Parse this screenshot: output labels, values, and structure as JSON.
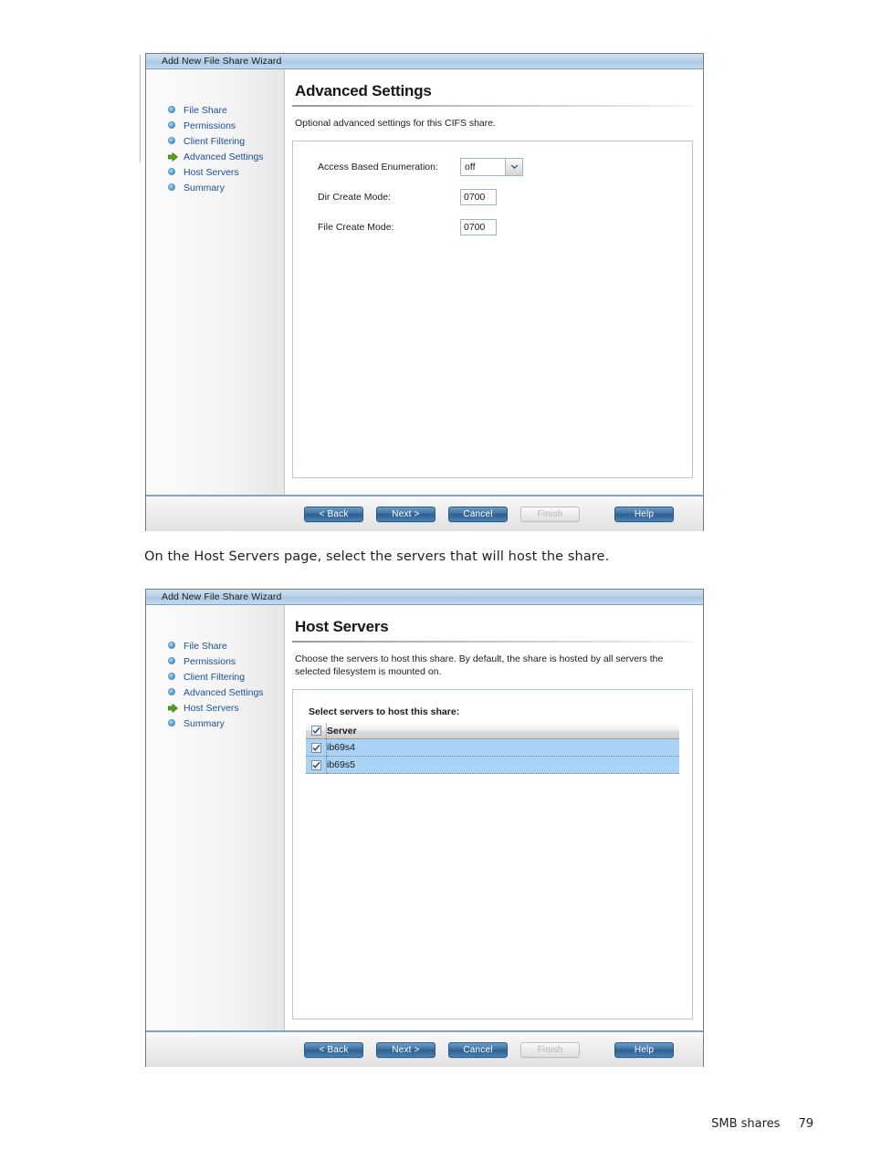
{
  "document": {
    "prose": "On the Host Servers page, select the servers that will host the share.",
    "footer_label": "SMB shares",
    "footer_page": "79"
  },
  "colors": {
    "link": "#1d4f91",
    "title_bar": "#b8d2ea",
    "button_primary": "#3f75a8",
    "row_selected": "#a8d3f7",
    "active_arrow": "#5a9e1e"
  },
  "wizard": {
    "title": "Add New File Share Wizard",
    "nav_items": [
      {
        "label": "File Share",
        "icon": "bullet-icon",
        "active": false
      },
      {
        "label": "Permissions",
        "icon": "bullet-icon",
        "active": false
      },
      {
        "label": "Client Filtering",
        "icon": "bullet-icon",
        "active": false
      },
      {
        "label": "Advanced Settings",
        "icon": "bullet-icon",
        "active": false
      },
      {
        "label": "Host Servers",
        "icon": "bullet-icon",
        "active": false
      },
      {
        "label": "Summary",
        "icon": "bullet-icon",
        "active": false
      }
    ],
    "buttons": [
      {
        "label": "< Back",
        "disabled": false
      },
      {
        "label": "Next >",
        "disabled": false
      },
      {
        "label": "Cancel",
        "disabled": false
      },
      {
        "label": "Finish",
        "disabled": true
      },
      {
        "label": "Help",
        "disabled": false
      }
    ]
  },
  "advanced": {
    "title": "Advanced Settings",
    "description": "Optional advanced settings for this CIFS share.",
    "active_step": "Advanced Settings",
    "fields": [
      {
        "label": "Access Based Enumeration:",
        "type": "select",
        "value": "off"
      },
      {
        "label": "Dir Create Mode:",
        "type": "text",
        "value": "0700"
      },
      {
        "label": "File Create Mode:",
        "type": "text",
        "value": "0700"
      }
    ]
  },
  "host_servers": {
    "title": "Host Servers",
    "description": "Choose the servers to host this share. By default, the share is hosted by all servers the selected filesystem is mounted on.",
    "active_step": "Host Servers",
    "table_caption": "Select servers to host this share:",
    "header_checked": true,
    "columns": [
      "Server"
    ],
    "rows": [
      {
        "checked": true,
        "server": "ib69s4"
      },
      {
        "checked": true,
        "server": "ib69s5"
      }
    ]
  }
}
